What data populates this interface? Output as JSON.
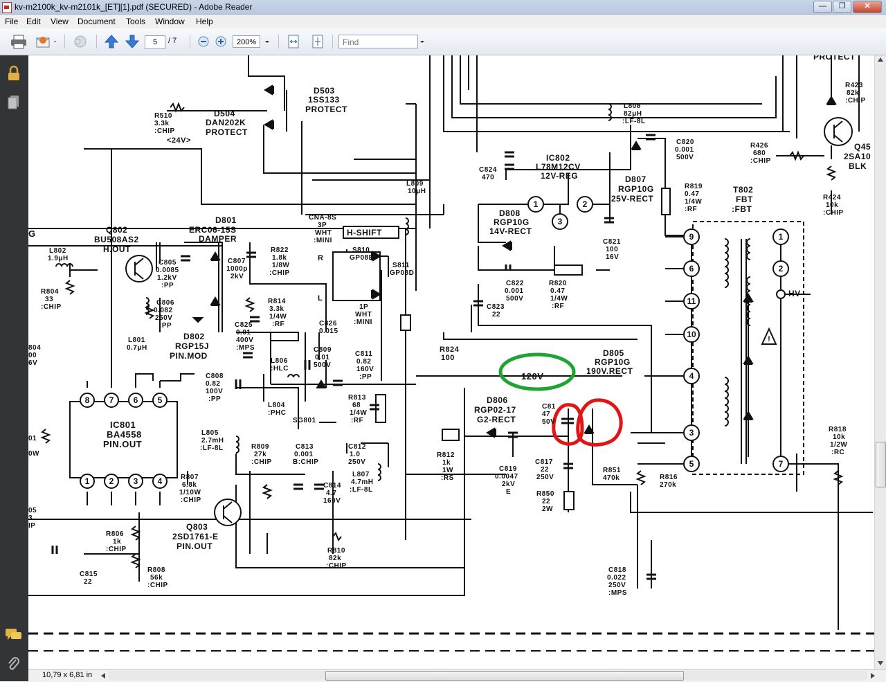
{
  "window": {
    "title": "kv-m2100k_kv-m2101k_[ET][1].pdf (SECURED) - Adobe Reader",
    "minimize": "—",
    "maximize": "❐",
    "close": "✕"
  },
  "menu": {
    "items": [
      "File",
      "Edit",
      "View",
      "Document",
      "Tools",
      "Window",
      "Help"
    ]
  },
  "toolbar": {
    "page_current": "5",
    "page_total": "/ 7",
    "zoom": "200%",
    "find_placeholder": "Find"
  },
  "status": {
    "page_size": "10,79 x 6,81 in"
  },
  "schematic": {
    "labels": {
      "d503": "D503",
      "d503_part": "1SS133",
      "d503_fn": "PROTECT",
      "d504": "D504",
      "d504_part": "DAN202K",
      "d504_fn": "PROTECT",
      "r510": "R510",
      "r510_val": "3.3k",
      "r510_type": ":CHIP",
      "v24": "<24V>",
      "ic802": "IC802",
      "ic802_part": "L78M12CV",
      "ic802_fn": "12V-REG",
      "c824": "C824",
      "c824_val": "470",
      "l809": "L809",
      "l809_val": "10μH",
      "l808": "L808",
      "l808_val": "82μH",
      "l808_type": ":LF-8L",
      "c820": "C820",
      "c820_val": "0.001",
      "c820_v": "500V",
      "d807": "D807",
      "d807_part": "RGP10G",
      "d807_fn": "25V-RECT",
      "r819": "R819",
      "r819_val": "0.47",
      "r819_w": "1/4W",
      "r819_type": ":RF",
      "t802": "T802",
      "t802_a": "FBT",
      "t802_b": ":FBT",
      "r426": "R426",
      "r426_val": "680",
      "r426_type": ":CHIP",
      "r423": "R423",
      "r423_val": "82k",
      "r423_type": ":CHIP",
      "q45": "Q45",
      "q45_part": "2SA10",
      "q45_col": "BLK",
      "r424": "R424",
      "r424_val": "10k",
      "r424_type": ":CHIP",
      "protect_top": "PROTECT",
      "d801": "D801",
      "d801_part": "ERC06-15S",
      "d801_fn": "DAMPER",
      "q802": "Q802",
      "q802_part": "BU508AS2",
      "q802_fn": "H.OUT",
      "l802": "L802",
      "l802_val": "1.9μH",
      "r804": "R804",
      "r804_val": "33",
      "r804_type": ":CHIP",
      "c805": "C805",
      "c805_val": "0.0085",
      "c805_v": "1.2kV",
      "c805_type": ":PP",
      "c807": "C807",
      "c807_val": "1000p",
      "c807_v": "2kV",
      "r822": "R822",
      "r822_val": "1.8k",
      "r822_w": "1/8W",
      "r822_type": ":CHIP",
      "cn": "CNA-8S",
      "cn_b": "3P",
      "cn_c": "WHT",
      "cn_d": ":MINI",
      "hshift": "H-SHIFT",
      "s810": "S810",
      "s810_part": "GP08B",
      "s811": "S811",
      "s811_part": "GP08D",
      "r_lbl": "R",
      "l_lbl": "L",
      "jp": "1P",
      "jp_c": "WHT",
      "jp_d": ":MINI",
      "d808": "D808",
      "d808_part": "RGP10G",
      "d808_fn": "14V-RECT",
      "c821": "C821",
      "c821_val": "100",
      "c821_v": "16V",
      "c822": "C822",
      "c822_val": "0.001",
      "c822_v": "500V",
      "r820": "R820",
      "r820_val": "0.47",
      "r820_w": "1/4W",
      "r820_type": ":RF",
      "c823": "C823",
      "c823_val": "22",
      "c806": "C806",
      "c806_val": "0.082",
      "c806_v": "250V",
      "c806_type": ":PP",
      "r814": "R814",
      "r814_val": "3.3k",
      "r814_w": "1/4W",
      "r814_type": ":RF",
      "c825": "C825",
      "c825_val": "0.01",
      "c825_v": "400V",
      "c825_type": ":MPS",
      "c826": "C826",
      "c826_val": "0.015",
      "c809": "C809",
      "c809_val": "0.01",
      "c809_v": "500V",
      "c811": "C811",
      "c811_val": "0.82",
      "c811_v": "160V",
      "c811_type": ":PP",
      "r824": "R824",
      "r824_val": "100",
      "l801": "L801",
      "l801_val": "0.7μH",
      "d802": "D802",
      "d802_part": "RGP15J",
      "d802_fn": "PIN.MOD",
      "l806": "L806",
      "l806_type": ":HLC",
      "v120": "120V",
      "d805": "D805",
      "d805_part": "RGP10G",
      "d805_fn": "190V.RECT",
      "hv": "HV",
      "c808": "C808",
      "c808_val": "0.82",
      "c808_v": "100V",
      "c808_type": ":PP",
      "l804": "L804",
      "l804_type": ":PHC",
      "sg801": "SG801",
      "r813": "R813",
      "r813_val": "68",
      "r813_w": "1/4W",
      "r813_type": ":RF",
      "d806": "D806",
      "d806_part": "RGP02-17",
      "d806_fn": "G2-RECT",
      "c81x": "C81",
      "c81x_val": "47",
      "c81x_v": "50V",
      "ic801": "IC801",
      "ic801_part": "BA4558",
      "ic801_fn": "PIN.OUT",
      "l805": "L805",
      "l805_val": "2.7mH",
      "l805_type": ":LF-8L",
      "r809": "R809",
      "r809_val": "27k",
      "r809_type": ":CHIP",
      "c813": "C813",
      "c813_val": "0.001",
      "c813_type": "B:CHIP",
      "c812": "C812",
      "c812_val": "1.0",
      "c812_v": "250V",
      "r812": "R812",
      "r812_val": "1k",
      "r812_w": "1W",
      "r812_type": ":RS",
      "c819": "C819",
      "c819_val": "0.0047",
      "c819_v": "2kV",
      "c819_type": "E",
      "c817": "C817",
      "c817_val": "22",
      "c817_v": "250V",
      "r851": "R851",
      "r851_val": "470k",
      "r816": "R816",
      "r816_val": "270k",
      "r818": "R818",
      "r818_val": "10k",
      "r818_w": "1/2W",
      "r818_type": ":RC",
      "r807": "R807",
      "r807_val": "6.8k",
      "r807_w": "1/10W",
      "r807_type": ":CHIP",
      "l807": "L807",
      "l807_val": "4.7mH",
      "l807_type": ":LF-8L",
      "c814": "C814",
      "c814_val": "4.7",
      "c814_v": "160V",
      "r850": "R850",
      "r850_val": "22",
      "r850_w": "2W",
      "q803": "Q803",
      "q803_part": "2SD1761-E",
      "q803_fn": "PIN.OUT",
      "r806": "R806",
      "r806_val": "1k",
      "r806_type": ":CHIP",
      "r810": "R810",
      "r810_val": "82k",
      "r810_type": ":CHIP",
      "c815": "C815",
      "c815_val": "22",
      "r808": "R808",
      "r808_val": "56k",
      "r808_type": ":CHIP",
      "c818": "C818",
      "c818_val": "0.022",
      "c818_v": "250V",
      "c818_type": ":MPS",
      "l_g": "G",
      "l_804": "804",
      "l_00": "00",
      "l_6v": "6V",
      "l_01": "01",
      "l_0w": "0W",
      "l_05": "05",
      "l_3": "3",
      "l_ip": "IP",
      "pins_ic": [
        "8",
        "7",
        "6",
        "5",
        "1",
        "2",
        "3",
        "4"
      ],
      "pins_fbt": [
        "9",
        "6",
        "11",
        "10",
        "4",
        "3",
        "5",
        "1",
        "2",
        "7"
      ]
    }
  }
}
